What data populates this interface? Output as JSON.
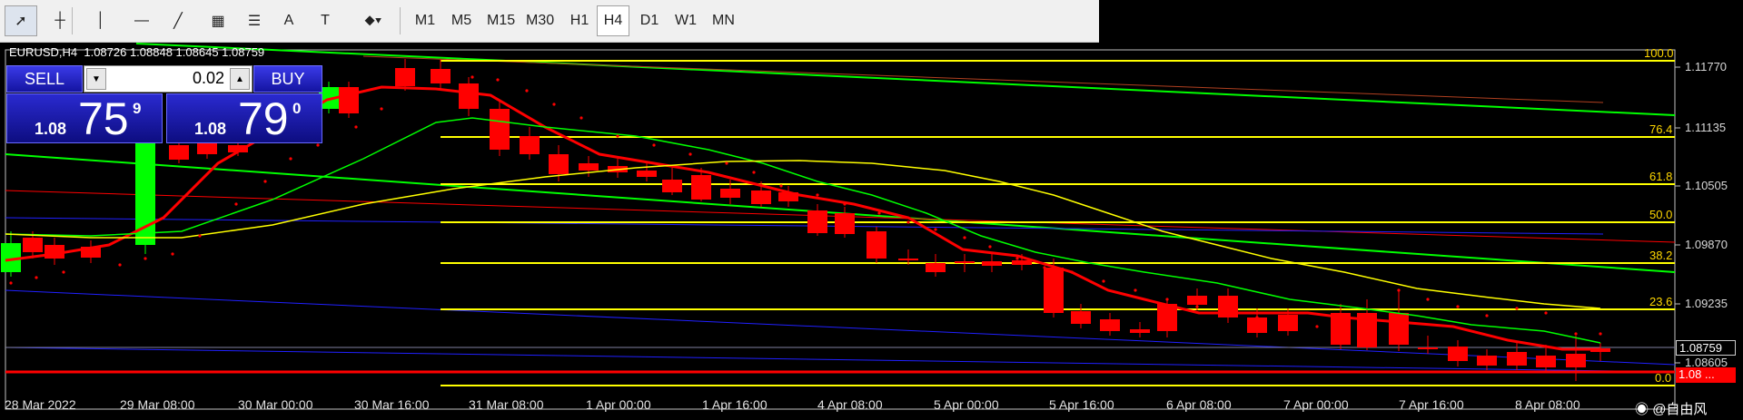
{
  "toolbar": {
    "tools": [
      {
        "name": "cursor-icon",
        "glyph": "➚"
      },
      {
        "name": "crosshair-icon",
        "glyph": "┼"
      },
      {
        "name": "vertical-line-icon",
        "glyph": "│"
      },
      {
        "name": "horizontal-line-icon",
        "glyph": "—"
      },
      {
        "name": "trendline-icon",
        "glyph": "╱"
      },
      {
        "name": "equidistant-channel-icon",
        "glyph": "▦"
      },
      {
        "name": "fibonacci-icon",
        "glyph": "☰"
      },
      {
        "name": "text-icon",
        "glyph": "A"
      },
      {
        "name": "text-label-icon",
        "glyph": "T"
      },
      {
        "name": "shapes-icon",
        "glyph": "⬥▾"
      }
    ],
    "timeframes": [
      "M1",
      "M5",
      "M15",
      "M30",
      "H1",
      "H4",
      "D1",
      "W1",
      "MN"
    ],
    "active_timeframe": "H4"
  },
  "chart": {
    "symbol_line": "EURUSD,H4  1.08726 1.08848 1.08645 1.08759",
    "price_labels": [
      "1.11770",
      "1.11135",
      "1.10505",
      "1.09870",
      "1.09235",
      "1.08605"
    ],
    "current_price": "1.08759",
    "current_price_red": "1.08 ...",
    "fib_levels": [
      "100.0",
      "76.4",
      "61.8",
      "50.0",
      "38.2",
      "23.6",
      "0.0"
    ],
    "x_labels": [
      "28 Mar 2022",
      "29 Mar 08:00",
      "30 Mar 00:00",
      "30 Mar 16:00",
      "31 Mar 08:00",
      "1 Apr 00:00",
      "1 Apr 16:00",
      "4 Apr 08:00",
      "5 Apr 00:00",
      "5 Apr 16:00",
      "6 Apr 08:00",
      "7 Apr 00:00",
      "7 Apr 16:00",
      "8 Apr 08:00"
    ],
    "colors": {
      "bull": "#00ff00",
      "bear": "#ff0000",
      "fib": "#ffff00",
      "ma_red": "#ff0000",
      "ma_green": "#00ff00",
      "ma_yellow": "#ffff00",
      "channel_blue": "#2020ff"
    }
  },
  "trade_panel": {
    "sell_label": "SELL",
    "buy_label": "BUY",
    "lot": "0.02",
    "sell": {
      "prefix": "1.08",
      "big": "75",
      "sup": "9"
    },
    "buy": {
      "prefix": "1.08",
      "big": "79",
      "sup": "0"
    }
  },
  "watermark": "@自由风"
}
